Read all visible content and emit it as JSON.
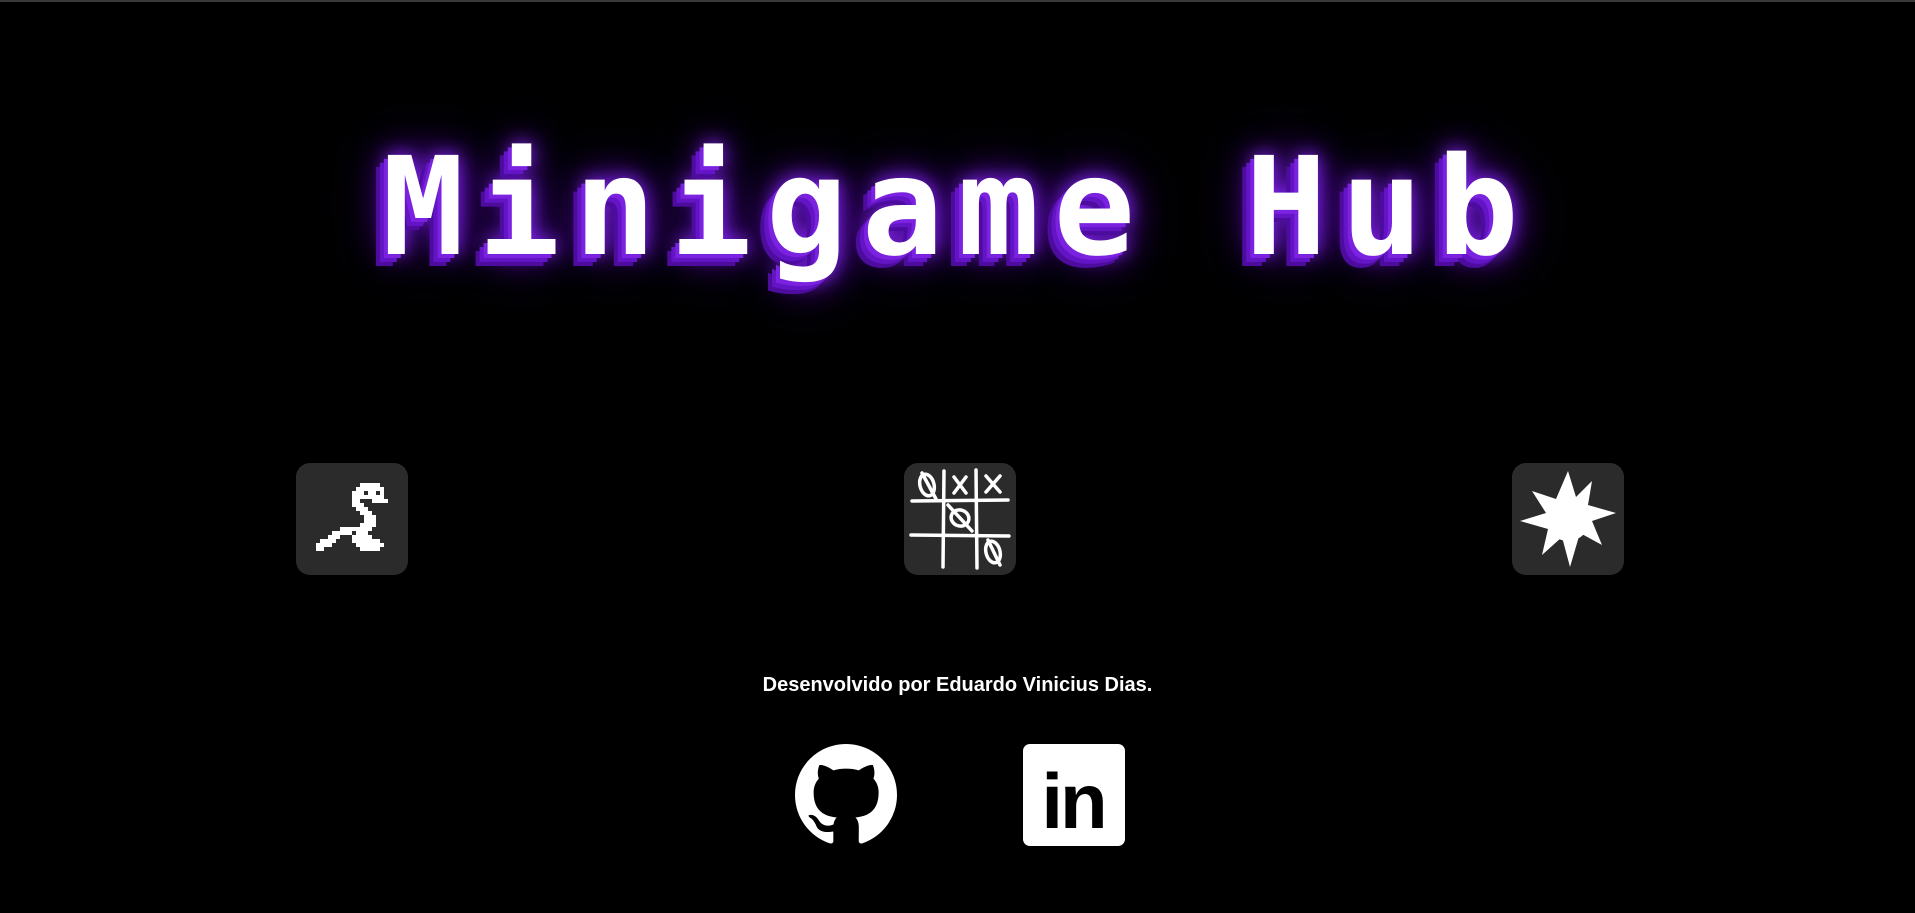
{
  "header": {
    "title": "Minigame Hub"
  },
  "games": [
    {
      "name": "snake",
      "icon": "snake-icon"
    },
    {
      "name": "tic-tac-toe",
      "icon": "tic-tac-toe-icon"
    },
    {
      "name": "minesweeper",
      "icon": "mine-icon"
    }
  ],
  "footer": {
    "credit": "Desenvolvido por Eduardo Vinicius Dias.",
    "links": [
      {
        "name": "github",
        "icon": "github-icon"
      },
      {
        "name": "linkedin",
        "icon": "linkedin-icon",
        "icon_text": "in"
      }
    ]
  },
  "colors": {
    "background": "#000000",
    "title_text": "#ffffff",
    "title_glow": "#7b22e0",
    "tile_background": "#2b2b2b",
    "footer_text": "#ffffff"
  }
}
